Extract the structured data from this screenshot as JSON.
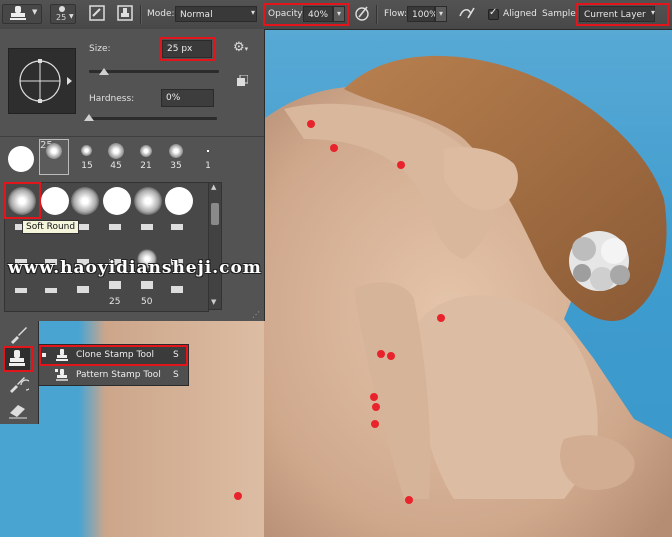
{
  "toolbar": {
    "brush_size": "25",
    "mode_label": "Mode:",
    "mode_value": "Normal",
    "opacity_label": "Opacity:",
    "opacity_value": "40%",
    "flow_label": "Flow:",
    "flow_value": "100%",
    "aligned_label": "Aligned",
    "aligned_checked": true,
    "sample_label": "Sample:",
    "sample_value": "Current Layer"
  },
  "brush_panel": {
    "size_label": "Size:",
    "size_value": "25 px",
    "hardness_label": "Hardness:",
    "hardness_value": "0%",
    "size_slider_fraction": 0.05,
    "hardness_slider_fraction": 0.0,
    "preset_sizes": [
      "25",
      "15",
      "45",
      "21",
      "35",
      "1"
    ],
    "grid_row3_labels": [
      "25",
      "50"
    ],
    "tooltip": "Soft Round"
  },
  "watermark": "www.haoyidiansheji.com",
  "flyout": {
    "items": [
      {
        "label": "Clone Stamp Tool",
        "key": "S",
        "selected": true
      },
      {
        "label": "Pattern Stamp Tool",
        "key": "S",
        "selected": false
      }
    ]
  },
  "icons": {
    "tool_preset": "clone-stamp-icon",
    "brush_panel_toggle": "brush-panel-icon",
    "clone_source_toggle": "clone-source-icon",
    "mode_dropdown": "chevron-down-icon",
    "pressure_opacity": "pressure-pen-icon",
    "airbrush": "airbrush-icon",
    "ignore_adjustment": "ignore-adjustment-icon",
    "brush_settings": "gear-icon",
    "new_preset": "new-preset-icon"
  },
  "colors": {
    "highlight": "#e2141c",
    "panel_bg": "#535353",
    "background_blue": "#4aa4d2",
    "skin": "#d9b59a"
  }
}
